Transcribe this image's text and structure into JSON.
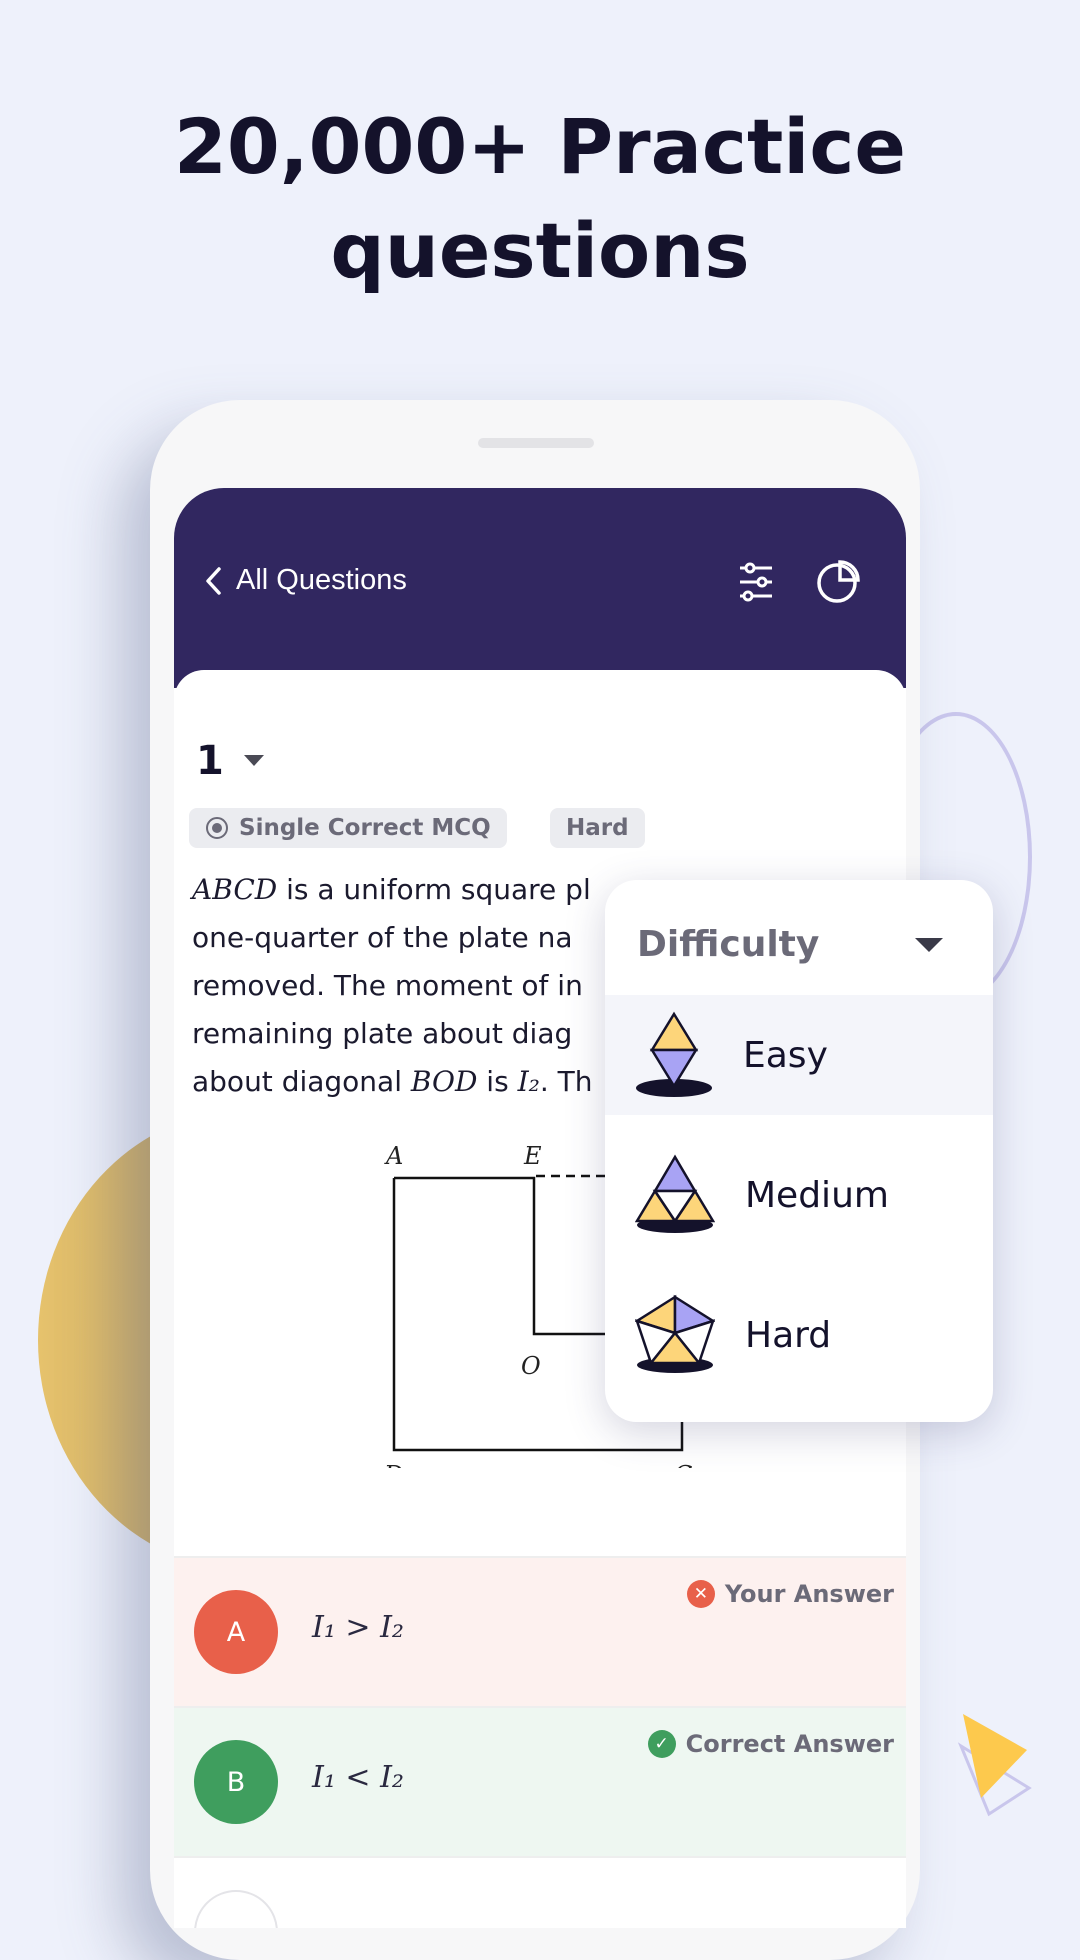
{
  "headline": {
    "line1": "20,000+ Practice",
    "line2": "questions"
  },
  "header": {
    "back_label": "All Questions",
    "icons": [
      "chevron-left-icon",
      "filter-sliders-icon",
      "pie-chart-icon"
    ],
    "color": "#312760"
  },
  "question": {
    "number": "1",
    "type_chip": "Single Correct MCQ",
    "difficulty_chip": "Hard",
    "lines": [
      {
        "italic": "ABCD",
        "text": " is a uniform square pl"
      },
      {
        "text": "one-quarter of the plate na"
      },
      {
        "text": "removed. The moment of in"
      },
      {
        "text": "remaining plate about diag"
      },
      {
        "pre": "about diagonal ",
        "italic": "BOD",
        "mid": " is ",
        "math": "I₂",
        "post": ". Th"
      }
    ],
    "diagram_labels": {
      "A": "A",
      "E": "E",
      "O": "O",
      "D": "D",
      "C": "C"
    }
  },
  "options": [
    {
      "letter": "A",
      "value": "I₁ > I₂",
      "tag": "Your Answer",
      "status": "wrong",
      "color": "#e8604a",
      "bg": "#fdf1ef"
    },
    {
      "letter": "B",
      "value": "I₁ < I₂",
      "tag": "Correct Answer",
      "status": "correct",
      "color": "#3f9e5e",
      "bg": "#eef7f1"
    }
  ],
  "dropdown": {
    "label": "Difficulty",
    "items": [
      {
        "label": "Easy",
        "selected": true
      },
      {
        "label": "Medium"
      },
      {
        "label": "Hard"
      }
    ]
  }
}
